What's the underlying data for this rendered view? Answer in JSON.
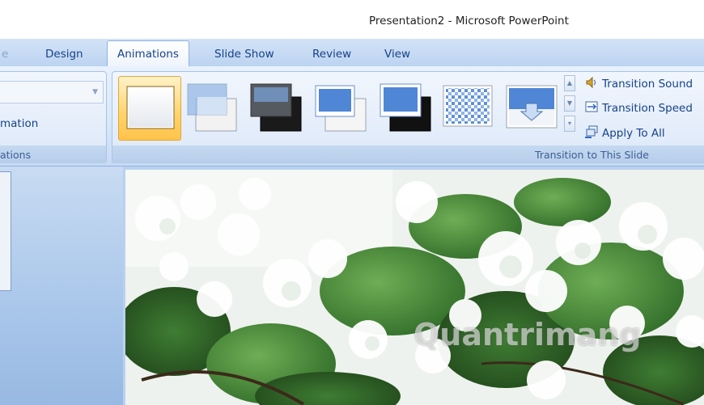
{
  "window": {
    "title": "Presentation2 - Microsoft PowerPoint"
  },
  "tabs": [
    {
      "label": "Design"
    },
    {
      "label": "Animations",
      "active": true
    },
    {
      "label": "Slide Show"
    },
    {
      "label": "Review"
    },
    {
      "label": "View"
    }
  ],
  "animations_group": {
    "custom_label": "mation",
    "group_label": "ations"
  },
  "transition_group": {
    "group_label": "Transition to This Slide",
    "thumbnails": [
      {
        "name": "No Transition",
        "selected": true
      },
      {
        "name": "Fade Smoothly"
      },
      {
        "name": "Fade Through Black"
      },
      {
        "name": "Cut"
      },
      {
        "name": "Cut Through Black"
      },
      {
        "name": "Dissolve"
      },
      {
        "name": "Wipe Down"
      }
    ],
    "commands": {
      "sound": "Transition Sound",
      "speed": "Transition Speed",
      "apply_all": "Apply To All"
    }
  },
  "colors": {
    "ribbon_text": "#15428b",
    "selected_thumb": "#ffd36a",
    "tab_bar": "#bcd3f0"
  },
  "watermark": "Quantrimang"
}
